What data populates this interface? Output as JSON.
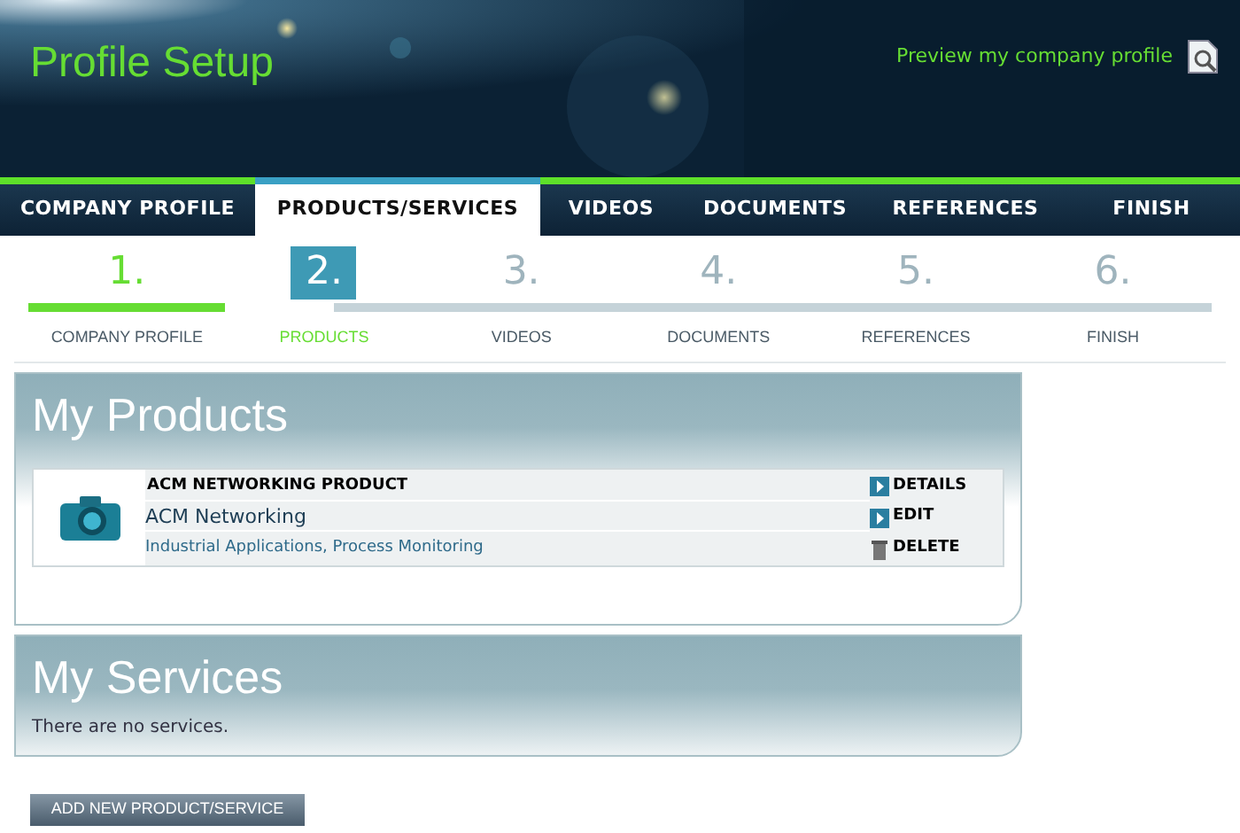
{
  "header": {
    "title": "Profile Setup",
    "preview_link": "Preview my company profile"
  },
  "tabs": [
    {
      "label": "COMPANY PROFILE",
      "selected": false
    },
    {
      "label": "PRODUCTS/SERVICES",
      "selected": true
    },
    {
      "label": "VIDEOS",
      "selected": false
    },
    {
      "label": "DOCUMENTS",
      "selected": false
    },
    {
      "label": "REFERENCES",
      "selected": false
    },
    {
      "label": "FINISH",
      "selected": false
    }
  ],
  "steps": [
    {
      "number": "1.",
      "label": "COMPANY PROFILE",
      "kind": "done"
    },
    {
      "number": "2.",
      "label": "PRODUCTS",
      "kind": "current"
    },
    {
      "number": "3.",
      "label": "VIDEOS",
      "kind": "upcoming"
    },
    {
      "number": "4.",
      "label": "DOCUMENTS",
      "kind": "upcoming"
    },
    {
      "number": "5.",
      "label": "REFERENCES",
      "kind": "upcoming"
    },
    {
      "number": "6.",
      "label": "FINISH",
      "kind": "upcoming"
    }
  ],
  "products": {
    "title": "My Products",
    "items": [
      {
        "name": "ACM NETWORKING PRODUCT",
        "company": "ACM Networking",
        "categories": "Industrial Applications, Process Monitoring",
        "actions": [
          {
            "label": "DETAILS",
            "kind": "arrow"
          },
          {
            "label": "EDIT",
            "kind": "arrow"
          },
          {
            "label": "DELETE",
            "kind": "trash"
          }
        ]
      }
    ]
  },
  "services": {
    "title": "My Services",
    "empty_text": "There are no services."
  },
  "add_button": "ADD NEW PRODUCT/SERVICE"
}
